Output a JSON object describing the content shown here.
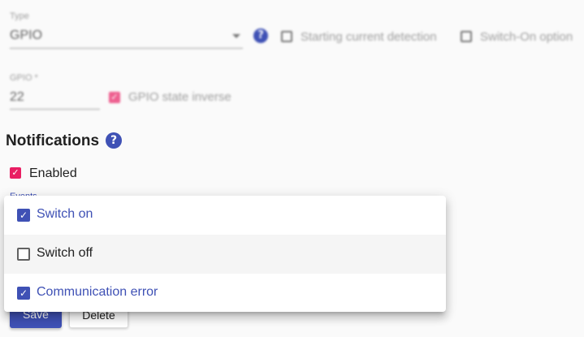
{
  "type_field": {
    "label": "Type",
    "value": "GPIO"
  },
  "starting_current_detection": {
    "label": "Starting current detection",
    "checked": false
  },
  "switch_on_option": {
    "label": "Switch-On option",
    "checked": false
  },
  "gpio_field": {
    "label": "GPIO *",
    "value": "22"
  },
  "gpio_state_inverse": {
    "label": "GPIO state inverse",
    "checked": true
  },
  "notifications": {
    "title": "Notifications",
    "help_icon": "?"
  },
  "enabled": {
    "label": "Enabled",
    "checked": true
  },
  "events": {
    "label": "Events"
  },
  "events_menu": {
    "items": [
      {
        "label": "Switch on",
        "checked": true
      },
      {
        "label": "Switch off",
        "checked": false
      },
      {
        "label": "Communication error",
        "checked": true
      }
    ]
  },
  "actions": {
    "save_label": "Save",
    "delete_label": "Delete"
  },
  "colors": {
    "primary": "#3f51b5",
    "accent": "#e91e63"
  },
  "icons": {
    "help": "help-circle-icon",
    "dropdown": "dropdown-arrow-icon",
    "check": "check-icon"
  }
}
